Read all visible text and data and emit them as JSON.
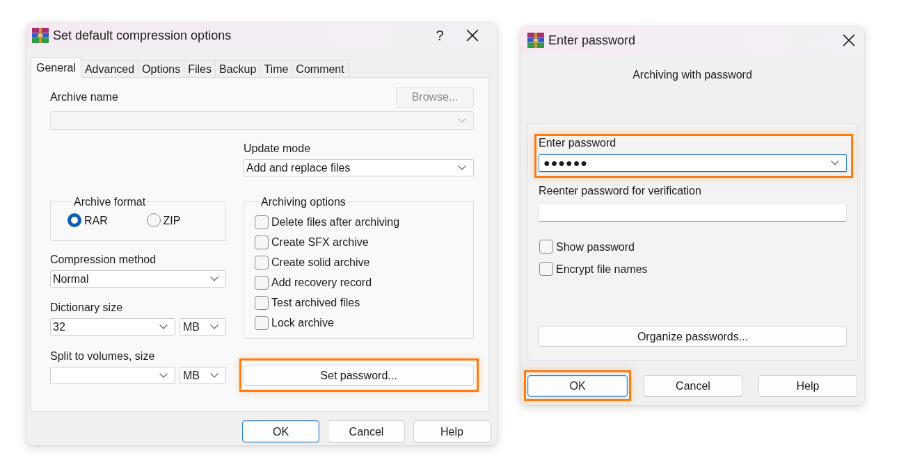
{
  "compression_dialog": {
    "title": "Set default compression options",
    "help_glyph": "?",
    "tabs": [
      {
        "label": "General",
        "selected": true
      },
      {
        "label": "Advanced",
        "selected": false
      },
      {
        "label": "Options",
        "selected": false
      },
      {
        "label": "Files",
        "selected": false
      },
      {
        "label": "Backup",
        "selected": false
      },
      {
        "label": "Time",
        "selected": false
      },
      {
        "label": "Comment",
        "selected": false
      }
    ],
    "archive_name": {
      "label": "Archive name",
      "disabled": true
    },
    "browse_button": {
      "label": "Browse...",
      "disabled": true
    },
    "update_mode": {
      "label": "Update mode",
      "value": "Add and replace files"
    },
    "archive_format": {
      "label": "Archive format",
      "options": [
        {
          "label": "RAR",
          "selected": true
        },
        {
          "label": "ZIP",
          "selected": false
        }
      ]
    },
    "compression_method": {
      "label": "Compression method",
      "value": "Normal"
    },
    "dictionary_size": {
      "label": "Dictionary size",
      "value": "32",
      "unit": "MB"
    },
    "split_volumes": {
      "label": "Split to volumes, size",
      "unit": "MB"
    },
    "archiving_options": {
      "label": "Archiving options",
      "items": [
        {
          "label": "Delete files after archiving",
          "checked": false
        },
        {
          "label": "Create SFX archive",
          "checked": false
        },
        {
          "label": "Create solid archive",
          "checked": false
        },
        {
          "label": "Add recovery record",
          "checked": false
        },
        {
          "label": "Test archived files",
          "checked": false
        },
        {
          "label": "Lock archive",
          "checked": false
        }
      ]
    },
    "set_password_button": {
      "label": "Set password...",
      "highlighted": true
    },
    "buttons": [
      {
        "label": "OK",
        "default": true,
        "highlighted": false
      },
      {
        "label": "Cancel",
        "default": false,
        "highlighted": false
      },
      {
        "label": "Help",
        "default": false,
        "highlighted": false
      }
    ]
  },
  "password_dialog": {
    "title": "Enter password",
    "subtitle": "Archiving with password",
    "password": {
      "label": "Enter password",
      "value": "●●●●●●",
      "focused": true,
      "highlighted": true
    },
    "verify": {
      "label": "Reenter password for verification",
      "focused": false
    },
    "options": [
      {
        "label": "Show password",
        "checked": false
      },
      {
        "label": "Encrypt file names",
        "checked": false
      }
    ],
    "organize_button": {
      "label": "Organize passwords..."
    },
    "buttons": [
      {
        "label": "OK",
        "default": true,
        "highlighted": true
      },
      {
        "label": "Cancel",
        "default": false,
        "highlighted": false
      },
      {
        "label": "Help",
        "default": false,
        "highlighted": false
      }
    ]
  }
}
